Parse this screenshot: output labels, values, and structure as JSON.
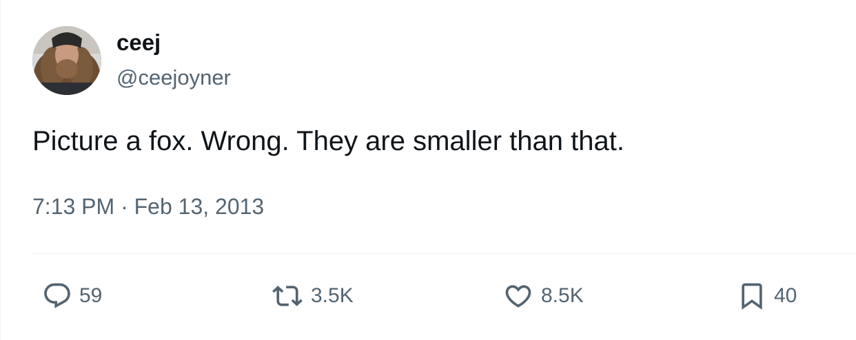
{
  "user": {
    "display_name": "ceej",
    "handle": "@ceejoyner"
  },
  "tweet": {
    "text": "Picture a fox. Wrong. They are smaller than that.",
    "timestamp": "7:13 PM · Feb 13, 2013"
  },
  "actions": {
    "reply": {
      "icon": "reply-icon",
      "count": "59"
    },
    "retweet": {
      "icon": "retweet-icon",
      "count": "3.5K"
    },
    "like": {
      "icon": "heart-icon",
      "count": "8.5K"
    },
    "bookmark": {
      "icon": "bookmark-icon",
      "count": "40"
    }
  },
  "colors": {
    "text_primary": "#0f1419",
    "text_secondary": "#536471",
    "divider": "#eff3f4"
  }
}
